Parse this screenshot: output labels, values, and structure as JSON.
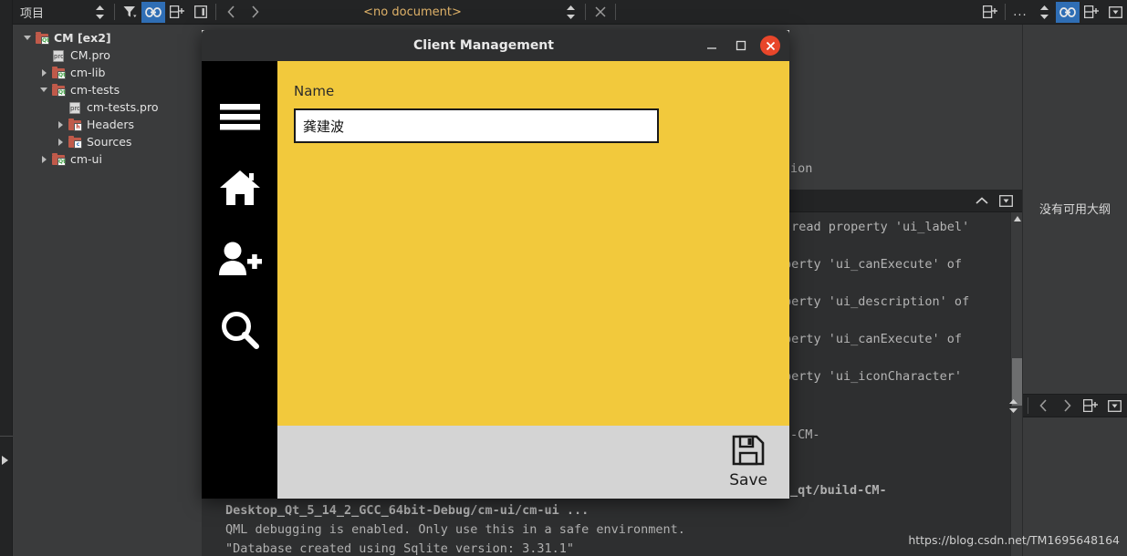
{
  "toolbar": {
    "panel_title": "项目",
    "document_label": "<no document>",
    "icons": {
      "sync": "sync-selector-icon",
      "filter": "filter-icon",
      "link": "link-icon",
      "split": "split-icon",
      "sidebar": "sidebar-toggle-icon",
      "back": "back-arrow-icon",
      "forward": "forward-arrow-icon",
      "more": "...",
      "close": "close-icon"
    }
  },
  "project_tree": [
    {
      "label": "CM [ex2]",
      "indent": 0,
      "twisty": "down",
      "icon": "folder-qt",
      "bold": true
    },
    {
      "label": "CM.pro",
      "indent": 1,
      "twisty": "none",
      "icon": "file-pro",
      "bold": false
    },
    {
      "label": "cm-lib",
      "indent": 1,
      "twisty": "right",
      "icon": "folder-qt",
      "bold": false
    },
    {
      "label": "cm-tests",
      "indent": 1,
      "twisty": "down",
      "icon": "folder-qt",
      "bold": false
    },
    {
      "label": "cm-tests.pro",
      "indent": 2,
      "twisty": "none",
      "icon": "file-pro",
      "bold": false
    },
    {
      "label": "Headers",
      "indent": 2,
      "twisty": "right",
      "icon": "folder-h",
      "bold": false
    },
    {
      "label": "Sources",
      "indent": 2,
      "twisty": "right",
      "icon": "folder-c",
      "bold": false
    },
    {
      "label": "cm-ui",
      "indent": 1,
      "twisty": "right",
      "icon": "folder-qt",
      "bold": false
    }
  ],
  "outline": {
    "empty_text": "没有可用大纲"
  },
  "console": {
    "hidden_fragment_1": "ion",
    "lines": [
      {
        "text": " read property 'ui_label'",
        "color": "gray"
      },
      {
        "text": "perty 'ui_canExecute' of",
        "color": "gray"
      },
      {
        "text": "perty 'ui_description' of",
        "color": "gray"
      },
      {
        "text": "perty 'ui_canExecute' of",
        "color": "gray"
      },
      {
        "text": "perty 'ui_iconCharacter'",
        "color": "gray"
      }
    ],
    "right_fragments": [
      {
        "text": "-CM-",
        "color": "gray"
      },
      {
        "text": "_qt/build-CM-",
        "color": "teal"
      }
    ],
    "bottom_lines": [
      {
        "text": "Desktop_Qt_5_14_2_GCC_64bit-Debug/cm-ui/cm-ui ...",
        "color": "teal"
      },
      {
        "text": "QML debugging is enabled. Only use this in a safe environment.",
        "color": "red"
      },
      {
        "text": "\"Database created using Sqlite version: 3.31.1\"",
        "color": "red"
      }
    ]
  },
  "dialog": {
    "title": "Client Management",
    "controls": {
      "minimize": "−",
      "maximize": "□",
      "close": "✕"
    },
    "sidebar_icons": [
      "hamburger-menu-icon",
      "home-icon",
      "add-user-icon",
      "search-icon"
    ],
    "form": {
      "label": "Name",
      "value": "龚建波",
      "placeholder": ""
    },
    "save": {
      "label": "Save",
      "icon": "floppy-disk-icon"
    }
  },
  "watermark": "https://blog.csdn.net/TM1695648164",
  "colors": {
    "accent_yellow": "#f2c93c",
    "dialog_footer": "#d4d4d4",
    "close_red": "#e8462a",
    "link_active_blue": "#2f6eb5",
    "log_teal": "#1d9e96",
    "log_red": "#e0675e"
  }
}
